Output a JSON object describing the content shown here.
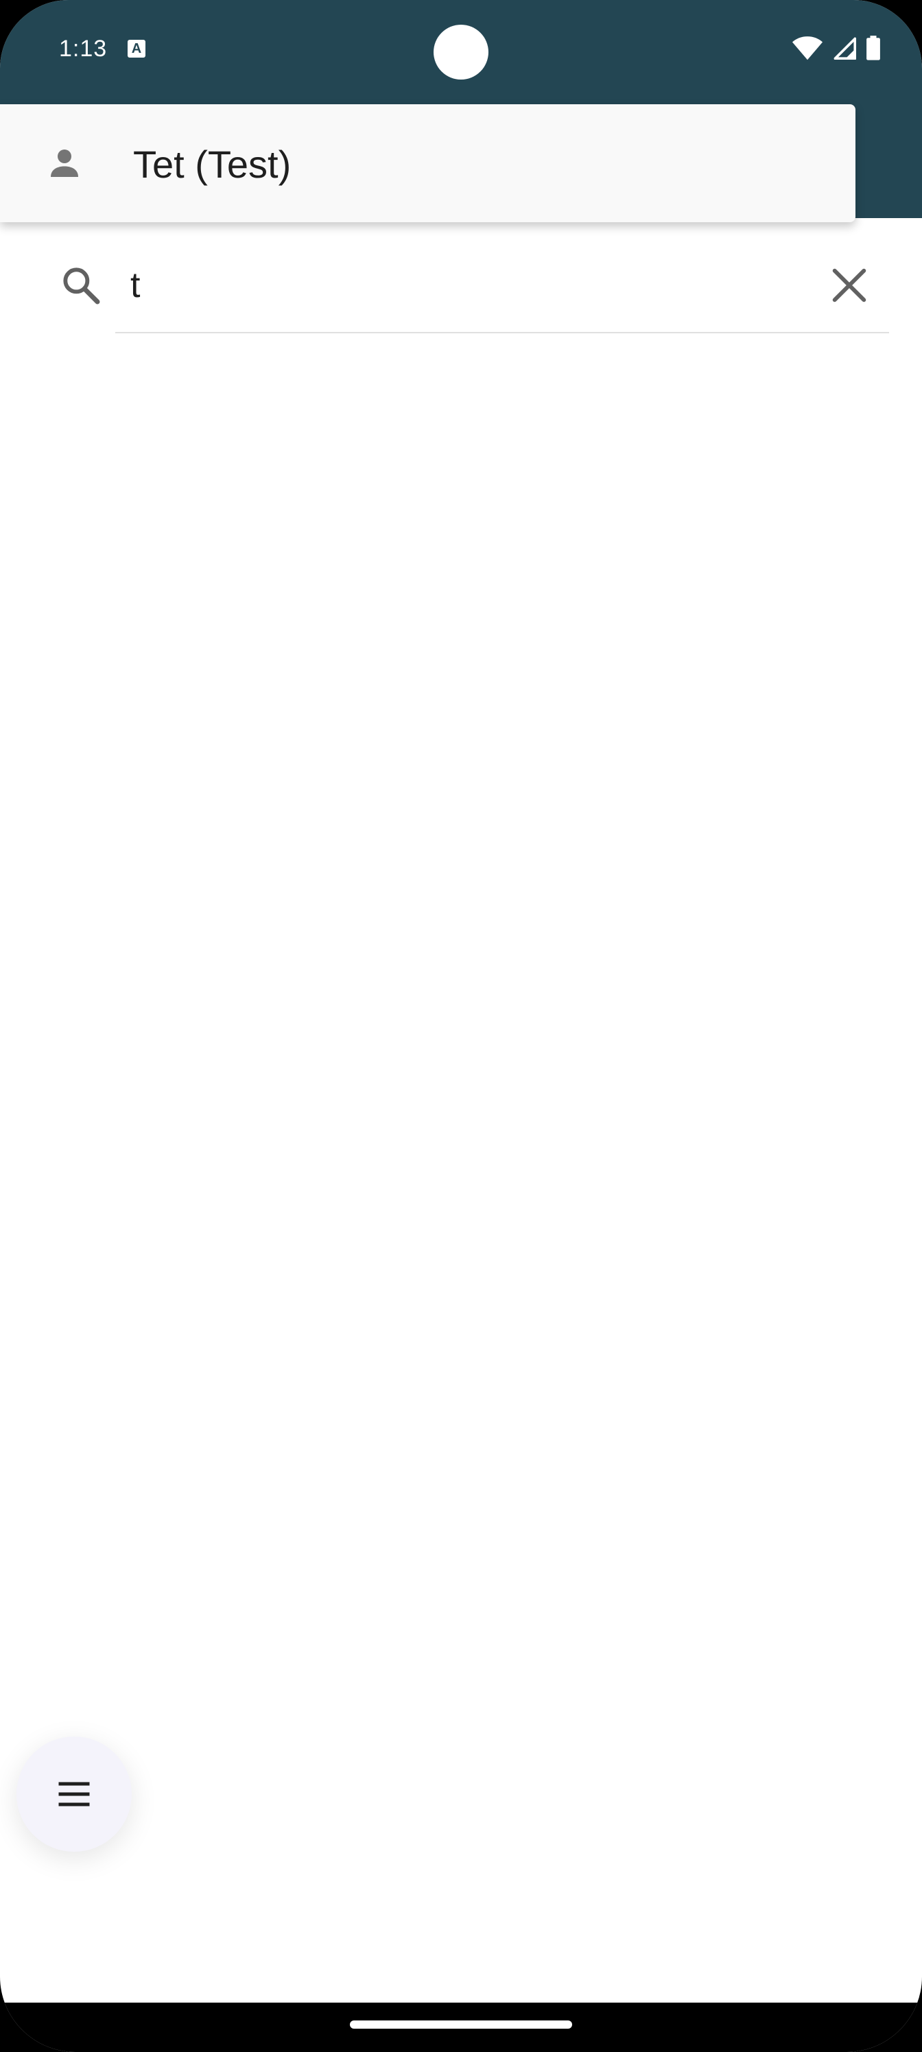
{
  "status_bar": {
    "time": "1:13",
    "keyboard_indicator": "A"
  },
  "suggestion": {
    "label": "Tet (Test)",
    "icon": "person-icon"
  },
  "search": {
    "value": "t",
    "icon": "search-icon",
    "clear_icon": "close-icon"
  },
  "fab": {
    "icon": "menu-icon"
  },
  "colors": {
    "app_bar": "#234653",
    "surface": "#ffffff",
    "suggestion_bg": "#f9f9f9",
    "fab_bg": "#f4f3fb",
    "icon_gray": "#757575",
    "text": "#1f1f1f"
  }
}
